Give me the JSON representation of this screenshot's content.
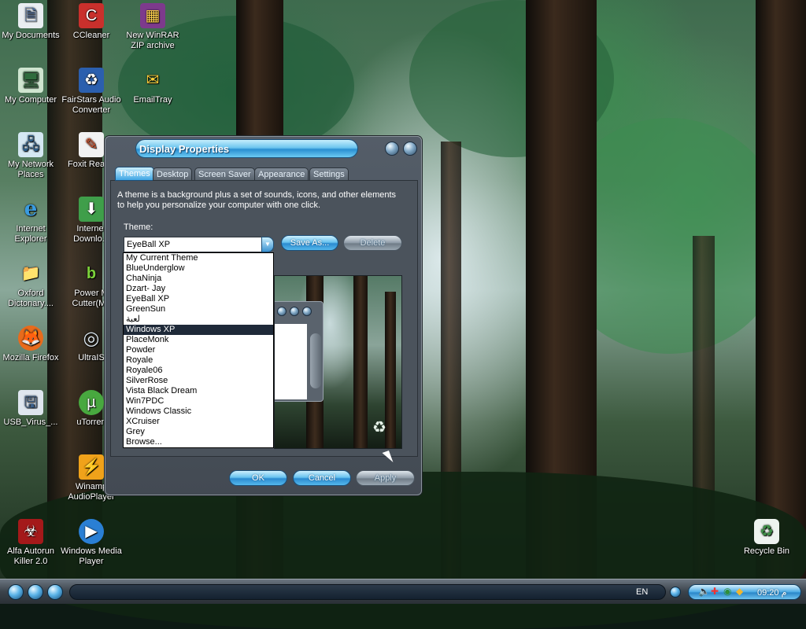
{
  "desktop": {
    "icons": [
      {
        "label": "My Documents",
        "glyph": "🗎"
      },
      {
        "label": "CCleaner",
        "glyph": "C"
      },
      {
        "label": "New WinRAR ZIP archive",
        "glyph": "▦"
      },
      {
        "label": "My Computer",
        "glyph": "🖥"
      },
      {
        "label": "FairStars Audio Converter",
        "glyph": "♻"
      },
      {
        "label": "EmailTray",
        "glyph": "✉"
      },
      {
        "label": "My Network Places",
        "glyph": "🖧"
      },
      {
        "label": "Foxit Rea",
        "glyph": "✎"
      },
      {
        "label": "Internet Explorer",
        "glyph": "e"
      },
      {
        "label": "Internet Downlo...",
        "glyph": "⬇"
      },
      {
        "label": "Oxford Dictonary....",
        "glyph": "📁"
      },
      {
        "label": "Power M Cutter(Mp",
        "glyph": "b"
      },
      {
        "label": "Mozilla Firefox",
        "glyph": "🦊"
      },
      {
        "label": "UltraIS",
        "glyph": "◎"
      },
      {
        "label": "USB_Virus_...",
        "glyph": "🖫"
      },
      {
        "label": "uTorren",
        "glyph": "µ"
      },
      {
        "label": "Winamp AudioPlayer",
        "glyph": "⚡"
      },
      {
        "label": "Alfa Autorun Killer 2.0",
        "glyph": "☣"
      },
      {
        "label": "Windows Media Player",
        "glyph": "▶"
      },
      {
        "label": "Recycle Bin",
        "glyph": "♻"
      }
    ]
  },
  "window": {
    "title": "Display Properties",
    "tabs": [
      "Themes",
      "Desktop",
      "Screen Saver",
      "Appearance",
      "Settings"
    ],
    "active_tab": "Themes",
    "description": "A theme is a background plus a set of sounds, icons, and other elements to help you personalize your computer with one click.",
    "theme_label": "Theme:",
    "theme_value": "EyeBall XP",
    "save_as_label": "Save As...",
    "delete_label": "Delete",
    "ok_label": "OK",
    "cancel_label": "Cancel",
    "apply_label": "Apply"
  },
  "dropdown": {
    "items": [
      "My Current Theme",
      "BlueUnderglow",
      "ChaNinja",
      "Dzart- Jay",
      "EyeBall XP",
      "GreenSun",
      "ﻟﻌﺒﺔ",
      "Windows XP",
      "PlaceMonk",
      "Powder",
      "Royale",
      "Royale06",
      "SilverRose",
      "Vista Black Dream",
      "Win7PDC",
      "Windows Classic",
      "XCruiser",
      "Grey",
      "Browse..."
    ],
    "selected": "Windows XP"
  },
  "taskbar": {
    "language": "EN",
    "time": "09:20 م"
  },
  "colors": {
    "accent": "#40a6e4",
    "window_body": "#4b535c",
    "selection": "#1f2a39"
  }
}
